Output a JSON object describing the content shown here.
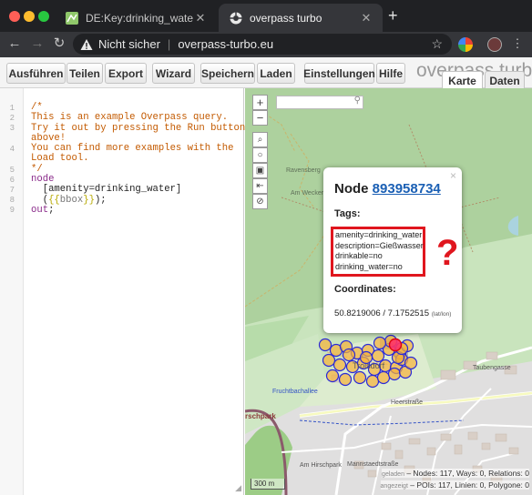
{
  "browser": {
    "tabs": [
      {
        "title": "DE:Key:drinking_water – OpenS",
        "active": false,
        "favicon": "openstreetmap-wiki-icon"
      },
      {
        "title": "overpass turbo",
        "active": true,
        "favicon": "overpass-turbo-icon"
      }
    ],
    "new_tab": "+",
    "tab_close": "✕",
    "security_label": "Nicht sicher",
    "url": "overpass-turbo.eu"
  },
  "toolbar": {
    "buttons": [
      "Ausführen",
      "Teilen",
      "Export",
      "Wizard",
      "Speichern",
      "Laden",
      "Einstellungen",
      "Hilfe"
    ],
    "logo": "overpass turbo",
    "view_tabs": [
      "Karte",
      "Daten"
    ]
  },
  "editor": {
    "line_numbers": [
      "1",
      "2",
      "3",
      "4",
      "5",
      "6",
      "7",
      "8",
      "9"
    ],
    "comment": {
      "l1": "/*",
      "l2": "This is an example Overpass query.",
      "l3": "Try it out by pressing the Run button",
      "l4": "above!",
      "l5": "You can find more examples with the",
      "l6": "Load tool.",
      "l7": "*/"
    },
    "kw_node": "node",
    "filter": "[amenity=drinking_water]",
    "open_paren": "(",
    "brace_open": "{{",
    "bbox": "bbox",
    "brace_close": "}}",
    "close_paren": ");",
    "kw_out": "out",
    "semicolon": ";"
  },
  "map": {
    "controls": [
      "+",
      "−",
      "⌕",
      "○",
      "▣",
      "⇤",
      "⊘"
    ],
    "labels": [
      {
        "text": "Ravensberg"
      },
      {
        "text": "Am Weckerberg"
      },
      {
        "text": "Troisdorf"
      },
      {
        "text": "Heerstraße"
      },
      {
        "text": "Am Hirschpark"
      },
      {
        "text": "Mannstaedtstraße"
      },
      {
        "text": "Taubengasse"
      },
      {
        "text": "rschpark"
      },
      {
        "text": "Fruchtbachallee"
      }
    ],
    "scale": "300 m",
    "stats": {
      "loaded_label": "geladen",
      "loaded": "– Nodes: 117, Ways: 0, Relations: 0",
      "shown_label": "angezeigt",
      "shown": "– POIs: 117, Linien: 0, Polygone: 0"
    }
  },
  "popup": {
    "title_prefix": "Node",
    "node_id": "893958734",
    "close": "×",
    "tags_heading": "Tags:",
    "tags": [
      "amenity=drinking_water",
      "description=Gießwasser",
      "drinkable=no",
      "drinking_water=no"
    ],
    "coords_heading": "Coordinates:",
    "coords": "50.8219006 / 7.1752515",
    "coords_unit": "(lat/lon)"
  },
  "annotation": {
    "mark": "?"
  },
  "colors": {
    "highlight": "#e0161e",
    "marker_fill": "#f7b23b",
    "marker_stroke": "#2a2ad8",
    "forest": "#add19e",
    "comment": "#c35a00",
    "keyword": "#8a2b8a"
  }
}
